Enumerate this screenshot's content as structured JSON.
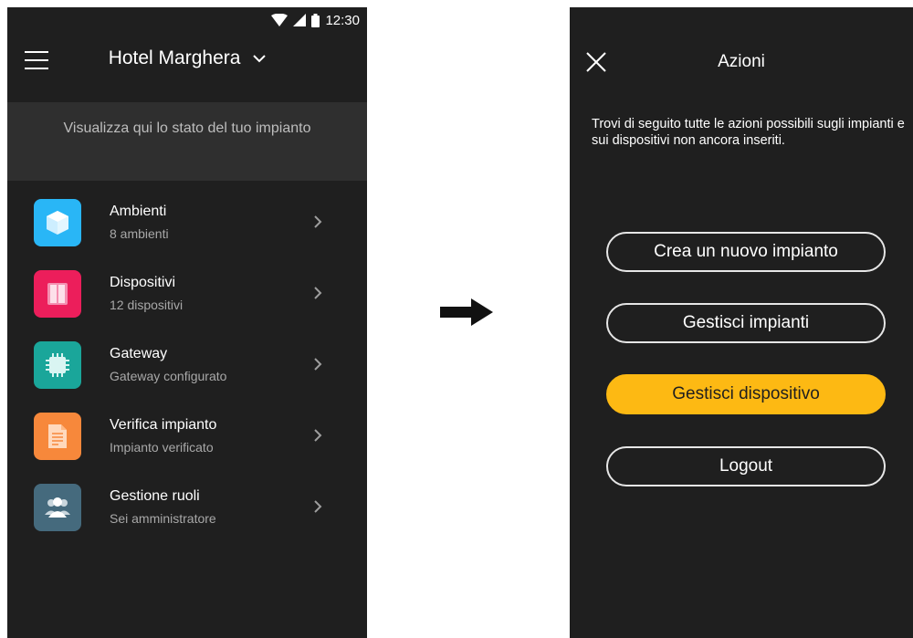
{
  "left_screen": {
    "status_bar": {
      "time": "12:30"
    },
    "header": {
      "title": "Hotel Marghera"
    },
    "banner": {
      "text": "Visualizza qui lo stato del tuo impianto"
    },
    "items": [
      {
        "title": "Ambienti",
        "subtitle": "8 ambienti",
        "icon": "cube-icon",
        "color": "#29b6f6"
      },
      {
        "title": "Dispositivi",
        "subtitle": "12 dispositivi",
        "icon": "device-icon",
        "color": "#ec1e5b"
      },
      {
        "title": "Gateway",
        "subtitle": "Gateway configurato",
        "icon": "chip-icon",
        "color": "#1aa69a"
      },
      {
        "title": "Verifica impianto",
        "subtitle": "Impianto verificato",
        "icon": "document-icon",
        "color": "#f7883b"
      },
      {
        "title": "Gestione ruoli",
        "subtitle": "Sei amministratore",
        "icon": "users-icon",
        "color": "#456a7d"
      }
    ]
  },
  "right_screen": {
    "header": {
      "title": "Azioni"
    },
    "intro": "Trovi di seguito tutte le azioni possibili sugli impianti e sui dispositivi non ancora inseriti.",
    "actions": [
      {
        "label": "Crea un nuovo impianto",
        "style": "outline"
      },
      {
        "label": "Gestisci impianti",
        "style": "outline"
      },
      {
        "label": "Gestisci dispositivo",
        "style": "primary"
      },
      {
        "label": "Logout",
        "style": "outline"
      }
    ]
  },
  "colors": {
    "background": "#1f1f1f",
    "banner": "#2f2f2f",
    "accent": "#fdb913"
  }
}
